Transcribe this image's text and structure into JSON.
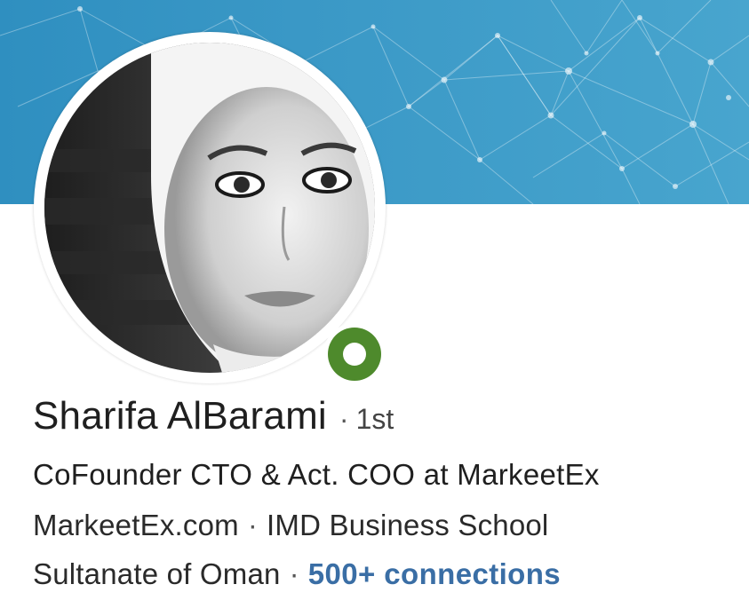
{
  "profile": {
    "name": "Sharifa AlBarami",
    "separator": "·",
    "degree": "1st",
    "headline": "CoFounder CTO & Act. COO at MarkeetEx",
    "company": "MarkeetEx.com",
    "school": "IMD Business School",
    "location": "Sultanate of Oman",
    "connections": "500+ connections"
  },
  "icons": {
    "presence": "online-status-icon",
    "avatar": "profile-photo"
  },
  "colors": {
    "banner": "#3a98c6",
    "presence_green": "#4e8a2c",
    "link_blue": "#3a6ea5",
    "text": "#1f1f1f"
  }
}
